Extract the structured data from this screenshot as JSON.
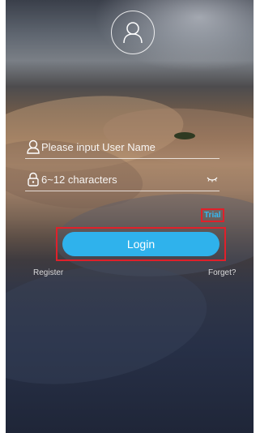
{
  "login": {
    "username_placeholder": "Please input User Name",
    "password_placeholder": "6~12 characters",
    "trial_label": "Trial",
    "login_label": "Login",
    "register_label": "Register",
    "forget_label": "Forget?"
  },
  "icons": {
    "avatar": "user-avatar-icon",
    "username": "user-icon",
    "password": "lock-icon",
    "show_password": "eye-icon"
  },
  "colors": {
    "accent": "#2fb2ec",
    "highlight_box": "#e0202a",
    "trial_text": "#37b8ef"
  }
}
